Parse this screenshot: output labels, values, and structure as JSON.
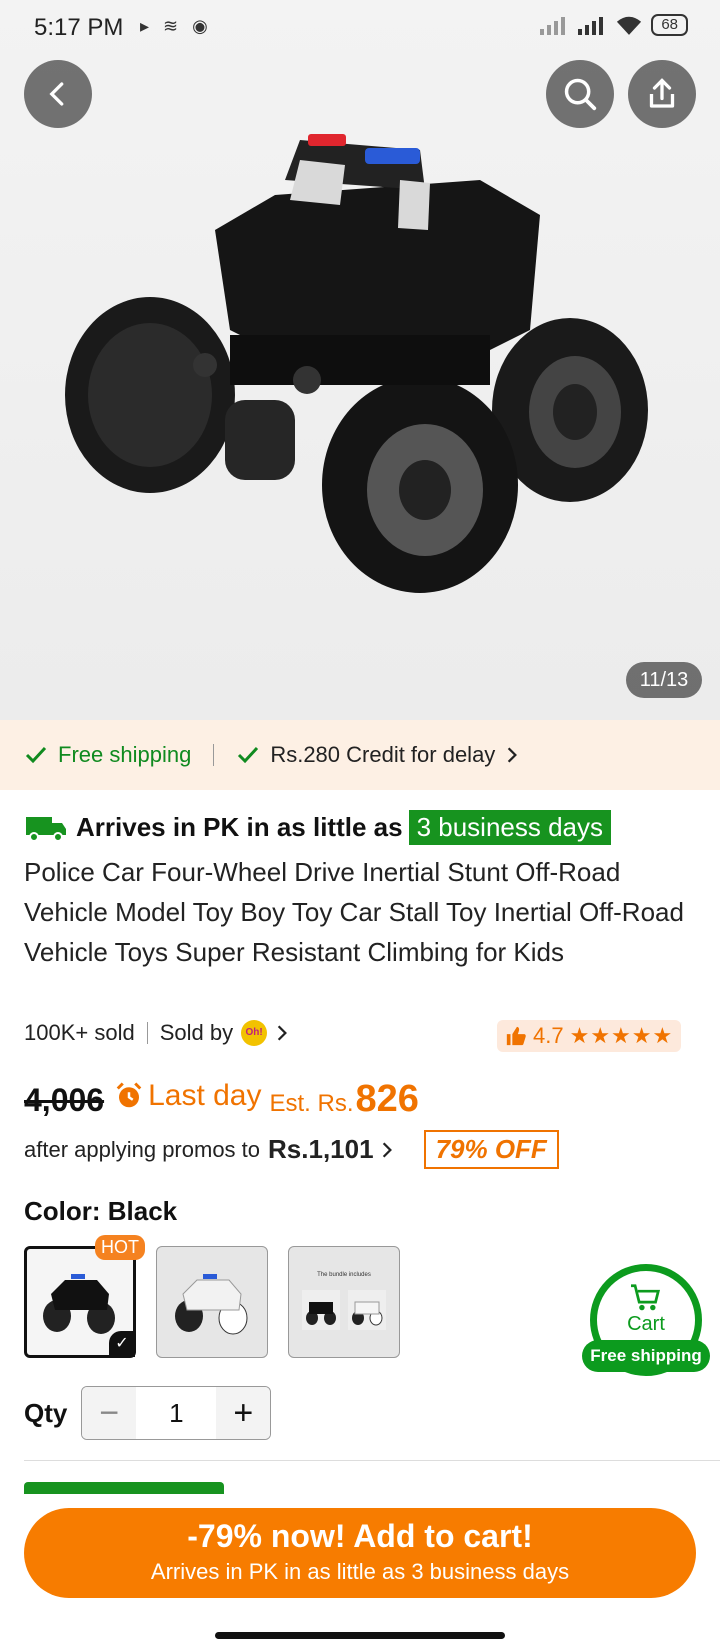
{
  "status_bar": {
    "time": "5:17 PM",
    "battery": "68"
  },
  "gallery": {
    "counter": "11/13"
  },
  "shipping": {
    "free": "Free shipping",
    "credit": "Rs.280 Credit for delay"
  },
  "arrival": {
    "text": "Arrives in PK in as little as",
    "badge": "3 business days"
  },
  "product": {
    "title": "Police Car Four-Wheel Drive Inertial Stunt Off-Road Vehicle Model Toy Boy Toy Car Stall Toy Inertial Off-Road Vehicle Toys Super Resistant Climbing for Kids",
    "sold": "100K+ sold",
    "sold_by": "Sold by",
    "seller_logo": "Oh!",
    "rating": "4.7",
    "stars": "★★★★★"
  },
  "price": {
    "old": "4,006",
    "last_day": "Last day",
    "est_label": "Est. Rs.",
    "est_value": "826",
    "promo_text": "after applying promos to",
    "promo_price": "Rs.1,101",
    "off": "79% OFF"
  },
  "color": {
    "label": "Color: Black",
    "hot": "HOT",
    "bundle_caption": "The bundle includes"
  },
  "cart_float": {
    "label": "Cart",
    "shipping": "Free shipping"
  },
  "qty": {
    "label": "Qty",
    "value": "1"
  },
  "cta": {
    "main": "-79% now! Add to cart!",
    "sub": "Arrives in PK in as little as 3 business days"
  },
  "colors": {
    "accent": "#f77c00",
    "green": "#17931f"
  }
}
